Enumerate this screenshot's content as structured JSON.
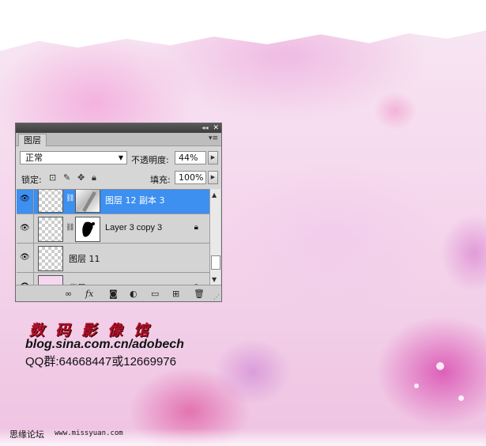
{
  "panel": {
    "tab_label": "图层",
    "blend_mode": "正常",
    "opacity_label": "不透明度:",
    "opacity_value": "44%",
    "lock_label": "锁定:",
    "fill_label": "填充:",
    "fill_value": "100%",
    "layers": [
      {
        "name": "图层 12 副本 3",
        "selected": true,
        "visible": true,
        "has_mask": true
      },
      {
        "name": "Layer 3 copy 3",
        "selected": false,
        "visible": true,
        "has_mask": true,
        "locked": true
      },
      {
        "name": "图层 11",
        "selected": false,
        "visible": true,
        "has_mask": false
      },
      {
        "name": "背景",
        "selected": false,
        "visible": true,
        "has_mask": false,
        "locked": true
      }
    ],
    "bottom_icons": [
      "link-icon",
      "fx-icon",
      "mask-icon",
      "adjustment-icon",
      "folder-icon",
      "new-layer-icon",
      "trash-icon"
    ],
    "fx_label": "fx"
  },
  "watermark": {
    "title": "数码影像馆",
    "url": "blog.sina.com.cn/adobech",
    "qq": "QQ群:64668447或12669976"
  },
  "footer": {
    "site_name": "思缘论坛",
    "site_url": "www.missyuan.com"
  },
  "colors": {
    "selection": "#3d8ff0",
    "brand_red": "#b0102a"
  }
}
